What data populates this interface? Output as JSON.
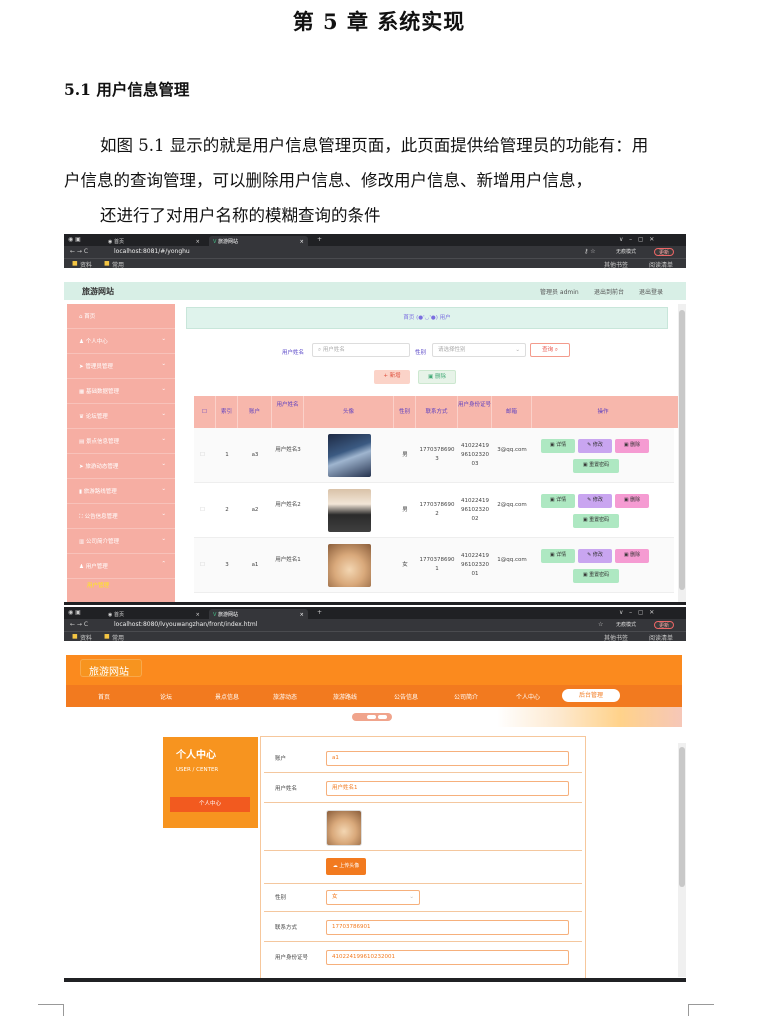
{
  "doc": {
    "chapter_title": "第 5 章 系统实现",
    "section_title": "5.1 用户信息管理",
    "para_line1": "如图 5.1 显示的就是用户信息管理页面，此页面提供给管理员的功能有：用",
    "para_line2": "户信息的查询管理，可以删除用户信息、修改用户信息、新增用户信息，",
    "para_line3": "还进行了对用户名称的模糊查询的条件"
  },
  "shot1": {
    "tabs": [
      "首页",
      "旅游网站"
    ],
    "url": "localhost:8081/#/yonghu",
    "bookmarks": [
      "资料",
      "常用"
    ],
    "bookmarks_right": [
      "其他书签",
      "阅读清单"
    ],
    "incognito": "无痕模式",
    "update": "更新",
    "app_title": "旅游网站",
    "header_right": [
      "管理员 admin",
      "退出到前台",
      "退出登录"
    ],
    "sidebar": [
      "首页",
      "个人中心",
      "管理员管理",
      "基础数据管理",
      "论坛管理",
      "景点信息管理",
      "旅游动态管理",
      "旅游路线管理",
      "公告信息管理",
      "公司简介管理",
      "用户管理",
      "用户管理"
    ],
    "breadcrumb": "首页 (●'◡'●) 用户",
    "search_label": "用户姓名",
    "search_placeholder": "用户姓名",
    "gender_label": "性别",
    "gender_placeholder": "请选择性别",
    "query_btn": "查询",
    "add_btn": "新增",
    "del_btn": "删除",
    "columns": [
      "",
      "索引",
      "账户",
      "用户姓名",
      "头像",
      "性别",
      "联系方式",
      "用户身份证号",
      "邮箱",
      "操作"
    ],
    "rows": [
      {
        "idx": "1",
        "account": "a3",
        "name": "用户姓名3",
        "gender": "男",
        "phone": "17703786903",
        "idcard": "410224199610232003",
        "email": "3@qq.com"
      },
      {
        "idx": "2",
        "account": "a2",
        "name": "用户姓名2",
        "gender": "男",
        "phone": "17703786902",
        "idcard": "410224199610232002",
        "email": "2@qq.com"
      },
      {
        "idx": "3",
        "account": "a1",
        "name": "用户姓名1",
        "gender": "女",
        "phone": "17703786901",
        "idcard": "410224199610232001",
        "email": "1@qq.com"
      }
    ],
    "op_detail": "详情",
    "op_edit": "修改",
    "op_delete": "删除",
    "op_reset": "重置密码"
  },
  "shot2": {
    "tabs": [
      "首页",
      "旅游网站"
    ],
    "url": "localhost:8080/lvyouwangzhan/front/index.html",
    "bookmarks": [
      "资料",
      "常用"
    ],
    "bookmarks_right": [
      "其他书签",
      "阅读清单"
    ],
    "incognito": "无痕模式",
    "update": "更新",
    "site_title": "旅游网站",
    "nav": [
      "首页",
      "论坛",
      "景点信息",
      "旅游动态",
      "旅游路线",
      "公告信息",
      "公司简介",
      "个人中心"
    ],
    "nav_admin": "后台管理",
    "card_title": "个人中心",
    "card_sub": "USER / CENTER",
    "card_btn": "个人中心",
    "f_account_label": "账户",
    "f_account": "a1",
    "f_name_label": "用户姓名",
    "f_name": "用户姓名1",
    "upload": "上传头像",
    "f_gender_label": "性别",
    "f_gender": "女",
    "f_phone_label": "联系方式",
    "f_phone": "17703786901",
    "f_id_label": "用户身份证号",
    "f_id": "410224199610232001"
  }
}
